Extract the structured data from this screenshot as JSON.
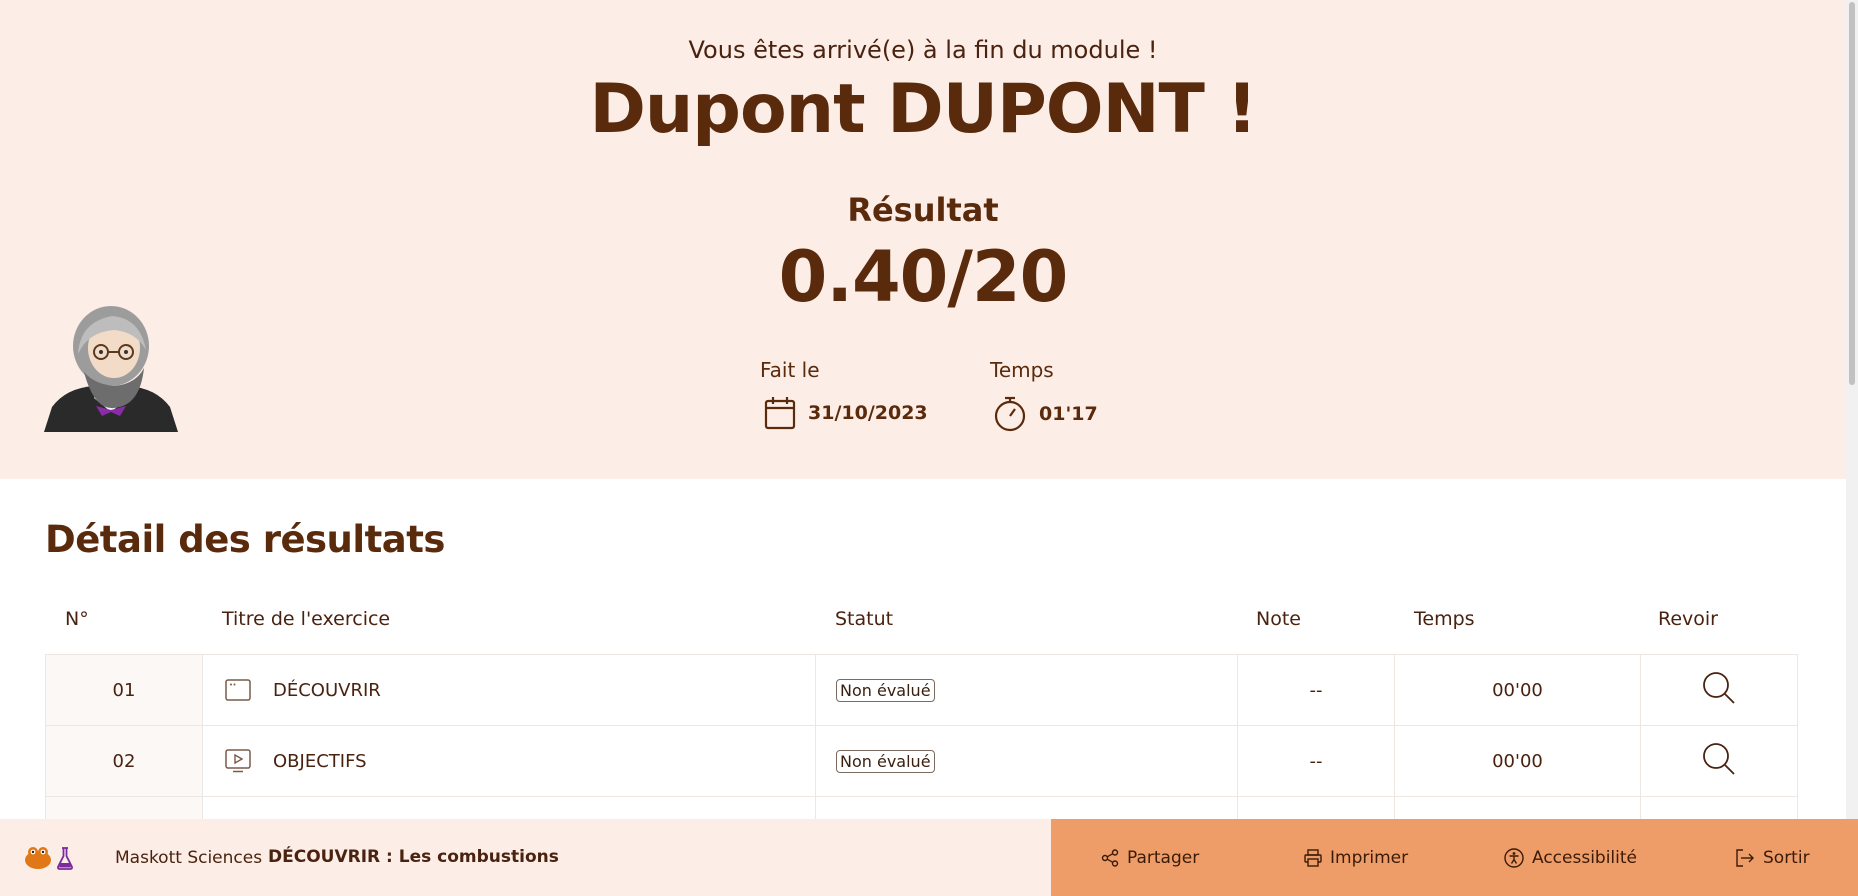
{
  "header": {
    "intro": "Vous êtes arrivé(e) à la fin du module !",
    "student_name": "Dupont DUPONT !",
    "result_label": "Résultat",
    "result_value": "0.40/20",
    "done_label": "Fait le",
    "done_date": "31/10/2023",
    "time_label": "Temps",
    "time_value": "01'17"
  },
  "details": {
    "title": "Détail des résultats",
    "columns": [
      "N°",
      "Titre de l'exercice",
      "Statut",
      "Note",
      "Temps",
      "Revoir"
    ],
    "rows": [
      {
        "num": "01",
        "icon": "window-icon",
        "title": "DÉCOUVRIR",
        "status": "Non évalué",
        "note": "--",
        "time": "00'00"
      },
      {
        "num": "02",
        "icon": "video-icon",
        "title": "OBJECTIFS",
        "status": "Non évalué",
        "note": "--",
        "time": "00'00"
      }
    ]
  },
  "footer": {
    "brand": "Maskott Sciences",
    "module": "DÉCOUVRIR : Les combustions",
    "actions": [
      {
        "icon": "share-icon",
        "label": "Partager"
      },
      {
        "icon": "printer-icon",
        "label": "Imprimer"
      },
      {
        "icon": "accessibility-icon",
        "label": "Accessibilité"
      },
      {
        "icon": "exit-icon",
        "label": "Sortir"
      }
    ]
  },
  "colors": {
    "hero_bg": "#fcede6",
    "text_brown": "#5a2a0c",
    "action_bar": "#ee9d68"
  }
}
